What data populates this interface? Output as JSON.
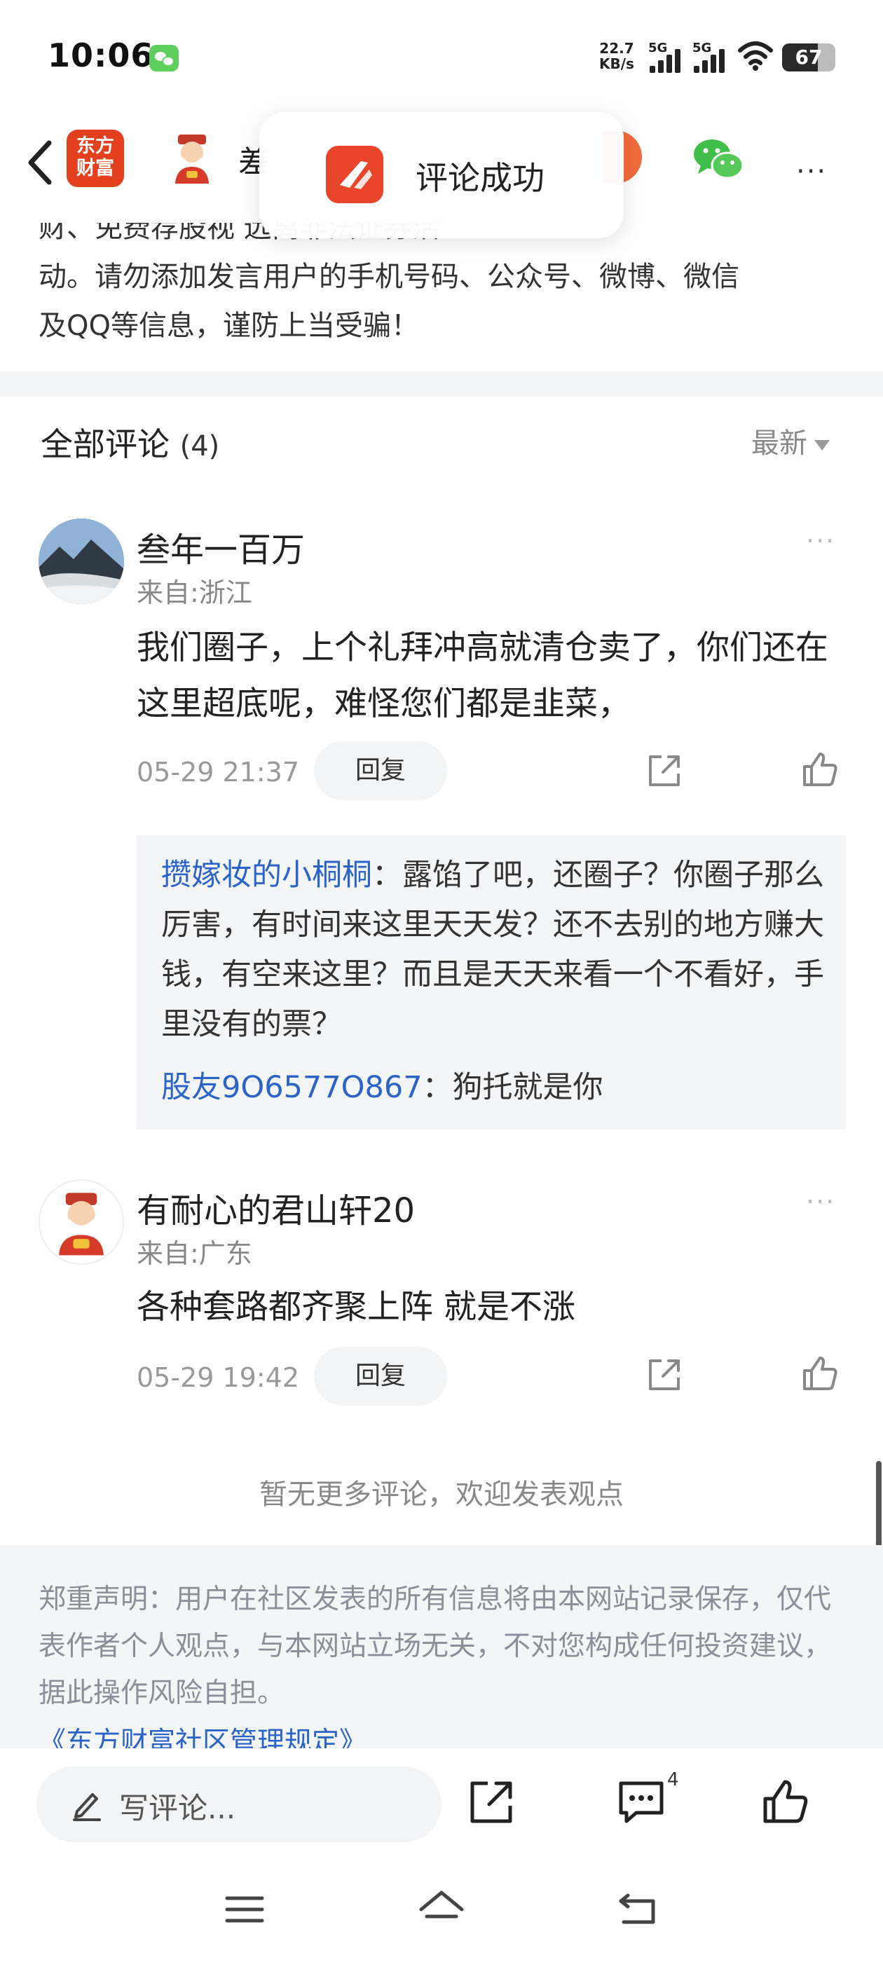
{
  "status_bar": {
    "time": "10:06",
    "net_speed_value": "22.7",
    "net_speed_unit": "KB/s",
    "signal1_label": "5G",
    "signal2_label": "5G",
    "battery": "67",
    "battery_level": 0.67
  },
  "nav": {
    "logo_line1": "东方",
    "logo_line2": "财富",
    "title_partial": "差",
    "more": "···"
  },
  "toast": {
    "text": "评论成功"
  },
  "notice": {
    "line1_partial": "财、免费荐股视                                                        远离非法证券活",
    "line2": "动。请勿添加发言用户的手机号码、公众号、微博、微信",
    "line3": "及QQ等信息，谨防上当受骗！"
  },
  "comments_header": {
    "title": "全部评论",
    "count": "(4)",
    "sort_label": "最新"
  },
  "comments": [
    {
      "username": "叁年一百万",
      "location": "来自:浙江",
      "text": "我们圈子，上个礼拜冲高就清仓卖了，你们还在这里超底呢，难怪您们都是韭菜，",
      "time": "05-29 21:37",
      "reply_label": "回复",
      "more": "···",
      "replies": [
        {
          "who": "攒嫁妆的小桐桐",
          "text": "：露馅了吧，还圈子？你圈子那么厉害，有时间来这里天天发？还不去别的地方赚大钱，有空来这里？而且是天天来看一个不看好，手里没有的票？"
        },
        {
          "who": "股友9O6577O867",
          "text": "：狗托就是你"
        }
      ]
    },
    {
      "username": "有耐心的君山轩20",
      "location": "来自:广东",
      "text": "各种套路都齐聚上阵 就是不涨",
      "time": "05-29 19:42",
      "reply_label": "回复",
      "more": "···"
    }
  ],
  "no_more": "暂无更多评论，欢迎发表观点",
  "disclaimer": {
    "text": "郑重声明：用户在社区发表的所有信息将由本网站记录保存，仅代表作者个人观点，与本网站立场无关，不对您构成任何投资建议，据此操作风险自担。",
    "link": "《东方财富社区管理规定》"
  },
  "bottom_bar": {
    "write_placeholder": "写评论...",
    "comment_badge": "4"
  }
}
